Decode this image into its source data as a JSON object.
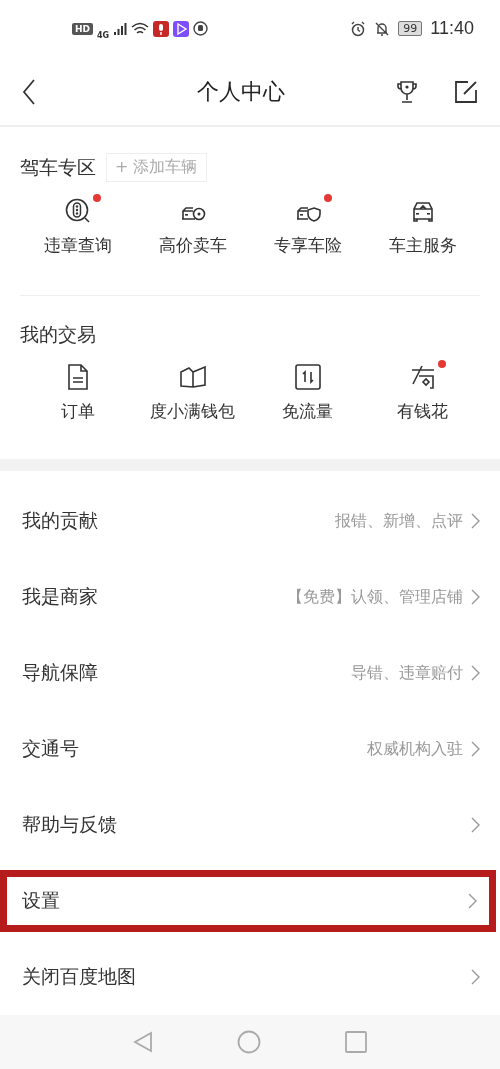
{
  "status_bar": {
    "network_badge": "HD",
    "network_type": "4G",
    "battery": "99",
    "time": "11:40"
  },
  "header": {
    "title": "个人中心"
  },
  "driving": {
    "title": "驾车专区",
    "add_button": "+ 添加车辆",
    "items": [
      {
        "kind": "traffic",
        "label": "违章查询",
        "dot": true
      },
      {
        "kind": "car-coin",
        "label": "高价卖车",
        "dot": false
      },
      {
        "kind": "car-shield",
        "label": "专享车险",
        "dot": true
      },
      {
        "kind": "car",
        "label": "车主服务",
        "dot": false
      }
    ]
  },
  "trade": {
    "title": "我的交易",
    "items": [
      {
        "kind": "document",
        "label": "订单",
        "dot": false
      },
      {
        "kind": "book",
        "label": "度小满钱包",
        "dot": false
      },
      {
        "kind": "arrows",
        "label": "免流量",
        "dot": false
      },
      {
        "kind": "glyph",
        "label": "有钱花",
        "dot": true
      }
    ]
  },
  "menu": [
    {
      "label": "我的贡献",
      "detail": "报错、新增、点评",
      "highlighted": false
    },
    {
      "label": "我是商家",
      "detail": "【免费】认领、管理店铺",
      "highlighted": false
    },
    {
      "label": "导航保障",
      "detail": "导错、违章赔付",
      "highlighted": false
    },
    {
      "label": "交通号",
      "detail": "权威机构入驻",
      "highlighted": false
    },
    {
      "label": "帮助与反馈",
      "highlighted": false
    },
    {
      "label": "设置",
      "highlighted": true
    },
    {
      "label": "关闭百度地图",
      "highlighted": false
    }
  ]
}
